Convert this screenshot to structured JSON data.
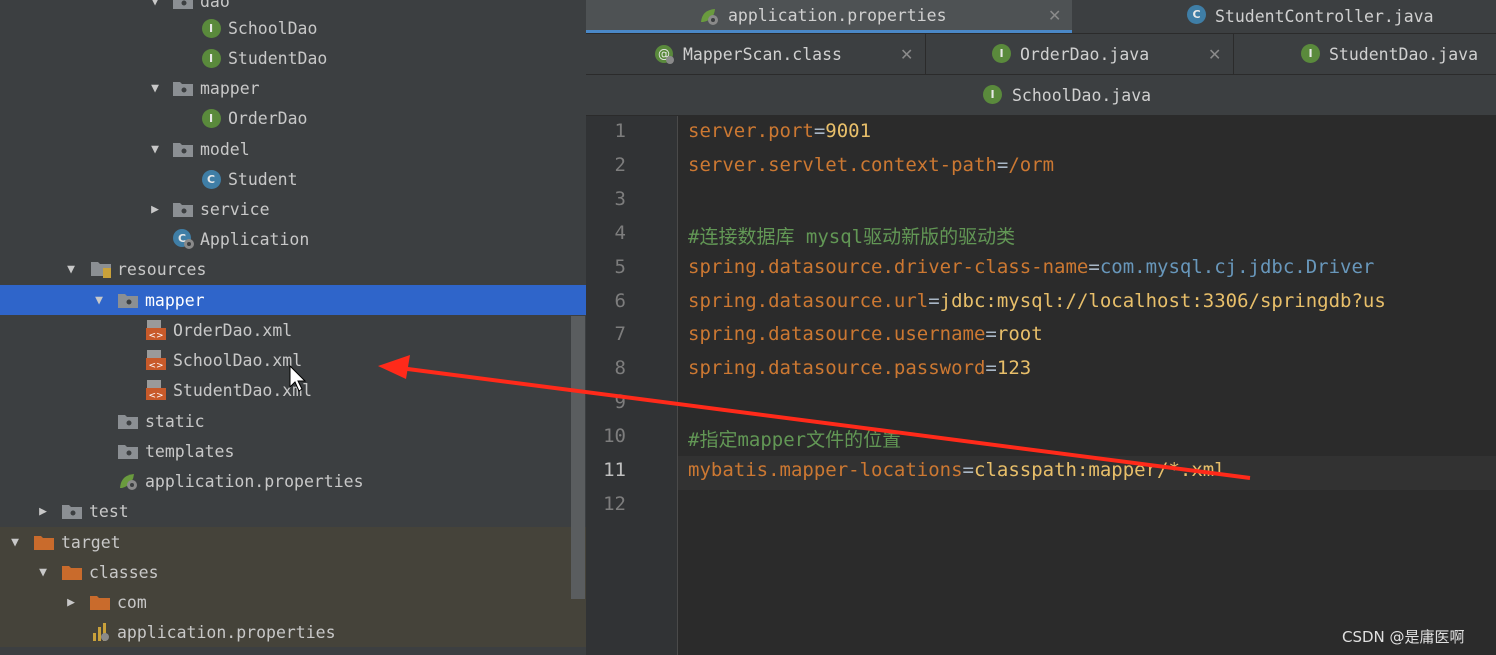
{
  "tree": {
    "items": [
      {
        "label": "dao",
        "kind": "folder"
      },
      {
        "label": "SchoolDao",
        "kind": "interface"
      },
      {
        "label": "StudentDao",
        "kind": "interface"
      },
      {
        "label": "mapper",
        "kind": "folder"
      },
      {
        "label": "OrderDao",
        "kind": "interface"
      },
      {
        "label": "model",
        "kind": "folder"
      },
      {
        "label": "Student",
        "kind": "class"
      },
      {
        "label": "service",
        "kind": "folder"
      },
      {
        "label": "Application",
        "kind": "app"
      },
      {
        "label": "resources",
        "kind": "resources"
      },
      {
        "label": "mapper",
        "kind": "folder",
        "selected": true
      },
      {
        "label": "OrderDao.xml",
        "kind": "xml"
      },
      {
        "label": "SchoolDao.xml",
        "kind": "xml"
      },
      {
        "label": "StudentDao.xml",
        "kind": "xml"
      },
      {
        "label": "static",
        "kind": "folder"
      },
      {
        "label": "templates",
        "kind": "folder"
      },
      {
        "label": "application.properties",
        "kind": "props"
      },
      {
        "label": "test",
        "kind": "folder"
      },
      {
        "label": "target",
        "kind": "folder-orange"
      },
      {
        "label": "classes",
        "kind": "folder-orange"
      },
      {
        "label": "com",
        "kind": "folder-orange"
      },
      {
        "label": "application.properties",
        "kind": "props-bar"
      }
    ]
  },
  "tabs": {
    "row1": [
      {
        "label": "application.properties",
        "active": true,
        "icon": "spring-props-icon"
      },
      {
        "label": "StudentController.java",
        "icon": "class-icon"
      }
    ],
    "row2": [
      {
        "label": "MapperScan.class",
        "icon": "annotation-icon"
      },
      {
        "label": "OrderDao.java",
        "icon": "interface-icon"
      },
      {
        "label": "StudentDao.java",
        "icon": "interface-icon"
      }
    ],
    "row3": [
      {
        "label": "SchoolDao.java",
        "icon": "interface-icon"
      }
    ]
  },
  "editor": {
    "current_line": 11,
    "lines": [
      {
        "n": "1",
        "key": "server.port",
        "eq": "=",
        "val": "9001",
        "valtype": "v"
      },
      {
        "n": "2",
        "key": "server.servlet.context-path",
        "eq": "=",
        "val": "/orm",
        "valtype": "k"
      },
      {
        "n": "3"
      },
      {
        "n": "4",
        "comment": "#连接数据库 mysql驱动新版的驱动类"
      },
      {
        "n": "5",
        "key": "spring.datasource.driver-class-name",
        "eq": "=",
        "val": "com.mysql.cj.jdbc.Driver",
        "valtype": "vn"
      },
      {
        "n": "6",
        "key": "spring.datasource.url",
        "eq": "=",
        "val": "jdbc:mysql://localhost:3306/springdb?us",
        "valtype": "v"
      },
      {
        "n": "7",
        "key": "spring.datasource.username",
        "eq": "=",
        "val": "root",
        "valtype": "v"
      },
      {
        "n": "8",
        "key": "spring.datasource.password",
        "eq": "=",
        "val": "123",
        "valtype": "v"
      },
      {
        "n": "9"
      },
      {
        "n": "10",
        "comment": "#指定mapper文件的位置"
      },
      {
        "n": "11",
        "key": "mybatis.mapper-locations",
        "eq": "=",
        "val": "classpath:mapper/*.xml",
        "valtype": "v"
      },
      {
        "n": "12"
      }
    ]
  },
  "watermark": "CSDN @是庸医啊",
  "colors": {
    "selection": "#2f65ca",
    "annotation_arrow": "#ff2a1a",
    "key": "#cc7832",
    "value": "#e8bf6a",
    "comment": "#629755"
  }
}
